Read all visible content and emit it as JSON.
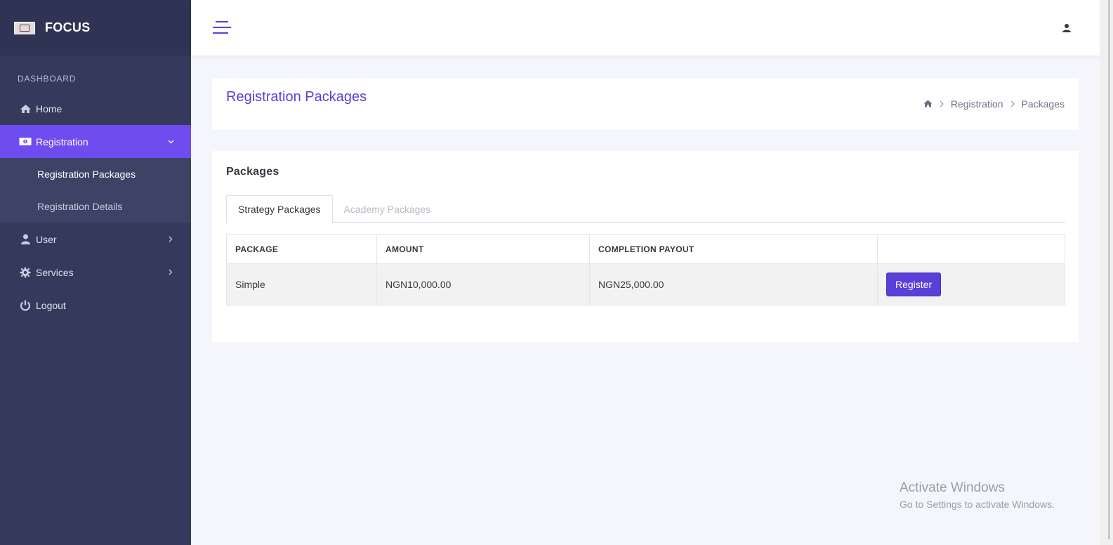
{
  "app": {
    "brand": "FOCUS"
  },
  "sidebar": {
    "section_label": "DASHBOARD",
    "items": [
      {
        "label": "Home",
        "icon": "home-icon"
      },
      {
        "label": "Registration",
        "icon": "money-icon",
        "active": true
      },
      {
        "label": "User",
        "icon": "user-icon"
      },
      {
        "label": "Services",
        "icon": "gear-icon"
      },
      {
        "label": "Logout",
        "icon": "power-icon"
      }
    ],
    "submenu": [
      {
        "label": "Registration Packages",
        "active": true
      },
      {
        "label": "Registration Details"
      }
    ]
  },
  "page": {
    "title": "Registration Packages",
    "breadcrumb": [
      "Registration",
      "Packages"
    ]
  },
  "packages": {
    "title": "Packages",
    "tabs": [
      "Strategy Packages",
      "Academy Packages"
    ],
    "columns": [
      "PACKAGE",
      "AMOUNT",
      "COMPLETION PAYOUT",
      ""
    ],
    "rows": [
      {
        "package": "Simple",
        "amount": "NGN10,000.00",
        "payout": "NGN25,000.00",
        "action": "Register"
      }
    ]
  },
  "watermark": {
    "title": "Activate Windows",
    "subtitle": "Go to Settings to activate Windows."
  },
  "colors": {
    "accent": "#5b3fd9",
    "sidebar_bg": "#353a5c",
    "active_item": "#6e4df0"
  }
}
